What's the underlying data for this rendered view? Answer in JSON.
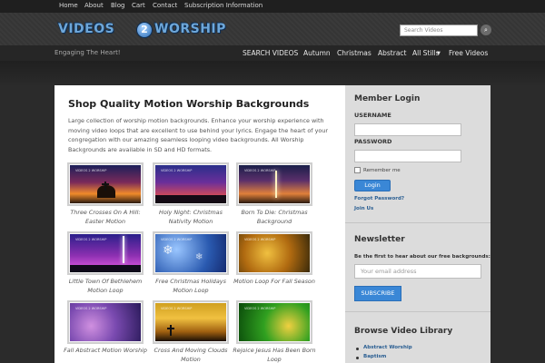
{
  "top_nav": [
    "Home",
    "About",
    "Blog",
    "Cart",
    "Contact",
    "Subscription Information"
  ],
  "logo": {
    "left_text": "VIDEOS",
    "number": "2",
    "right_text": "WORSHIP"
  },
  "search": {
    "placeholder": "Search Videos"
  },
  "tagline": "Engaging The Heart!",
  "main_nav": [
    "SEARCH VIDEOS",
    "Autumn",
    "Christmas",
    "Abstract",
    "All Stills",
    "Free Videos"
  ],
  "main": {
    "title": "Shop Quality Motion Worship Backgrounds",
    "description": "Large collection of worship motion backgrounds. Enhance your worship experience with moving video loops that are excellent to use behind your lyrics. Engage the heart of your congregation with our amazing seamless looping video backgrounds. All Worship Backgrounds are available in SD and HD formats.",
    "products": [
      {
        "caption": "Three Crosses On A Hill: Easter Motion"
      },
      {
        "caption": "Holy Night: Christmas Nativity Motion"
      },
      {
        "caption": "Born To Die: Christmas Background"
      },
      {
        "caption": "Little Town Of Bethlehem Motion Loop"
      },
      {
        "caption": "Free Christmas Holidays Motion Loop"
      },
      {
        "caption": "Motion Loop For Fall Season"
      },
      {
        "caption": "Fall Abstract Motion Worship"
      },
      {
        "caption": "Cross And Moving Clouds Motion"
      },
      {
        "caption": "Rejoice Jesus Has Been Born Loop"
      }
    ]
  },
  "sidebar": {
    "member_login": {
      "title": "Member Login",
      "username_label": "USERNAME",
      "password_label": "PASSWORD",
      "remember": "Remember me",
      "login_button": "Login",
      "forgot": "Forgot Password?",
      "join": "Join Us"
    },
    "newsletter": {
      "title": "Newsletter",
      "text": "Be the first to hear about our free backgrounds:",
      "placeholder": "Your email address",
      "button": "SUBSCRIBE"
    },
    "library": {
      "title": "Browse Video Library",
      "items": [
        "Abstract Worship",
        "Baptism"
      ]
    }
  }
}
